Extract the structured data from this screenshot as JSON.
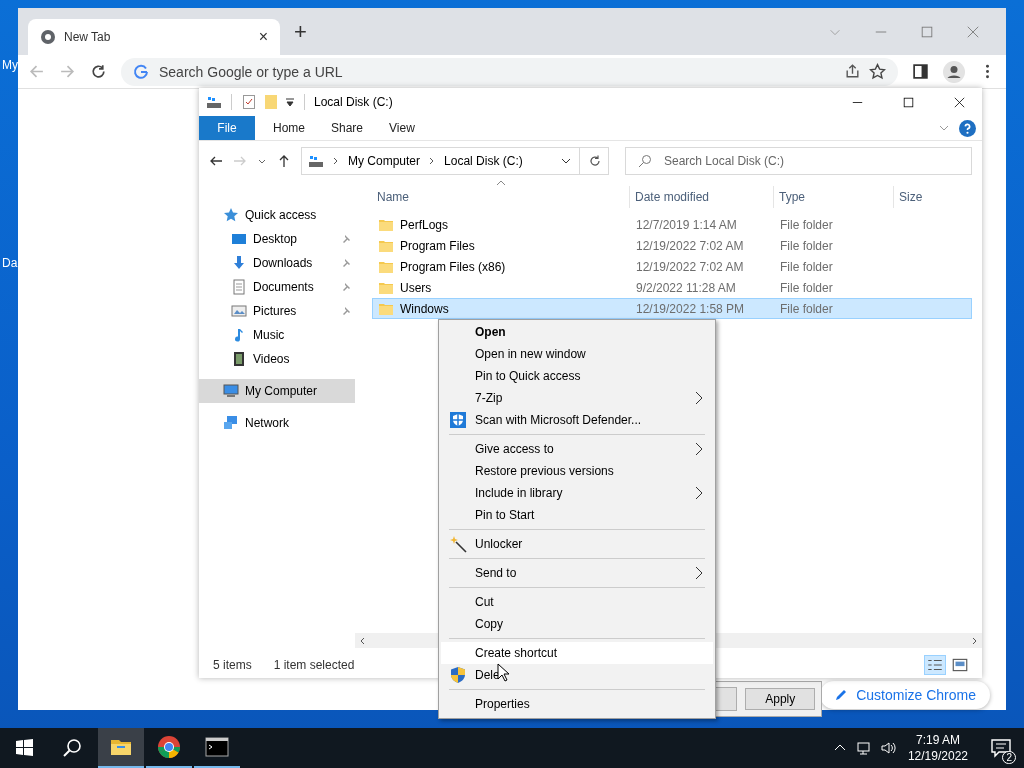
{
  "desktop": {
    "icon_labels": [
      "My",
      "Da"
    ]
  },
  "browser": {
    "tab": {
      "title": "New Tab",
      "close": "×"
    },
    "new_tab": "+",
    "omnibox": {
      "placeholder": "Search Google or type a URL"
    },
    "customize_button": "Customize Chrome"
  },
  "explorer": {
    "title": "Local Disk (C:)",
    "ribbon_tabs": [
      {
        "label": "File",
        "kind": "menu"
      },
      {
        "label": "Home",
        "kind": "tab"
      },
      {
        "label": "Share",
        "kind": "tab"
      },
      {
        "label": "View",
        "kind": "tab"
      }
    ],
    "address": {
      "crumbs": [
        "My Computer",
        "Local Disk (C:)"
      ]
    },
    "search": {
      "placeholder": "Search Local Disk (C:)"
    },
    "nav": [
      {
        "label": "Quick access",
        "kind": "star",
        "selected": false,
        "children": [
          {
            "label": "Desktop",
            "kind": "desktop",
            "selected": false,
            "pinned": true
          },
          {
            "label": "Downloads",
            "kind": "downloads",
            "selected": false,
            "pinned": true
          },
          {
            "label": "Documents",
            "kind": "documents",
            "selected": false,
            "pinned": true
          },
          {
            "label": "Pictures",
            "kind": "pictures",
            "selected": false,
            "pinned": true
          },
          {
            "label": "Music",
            "kind": "music",
            "selected": false,
            "pinned": false
          },
          {
            "label": "Videos",
            "kind": "videos",
            "selected": false,
            "pinned": false
          }
        ]
      },
      {
        "label": "My Computer",
        "kind": "computer",
        "selected": true
      },
      {
        "label": "Network",
        "kind": "network",
        "selected": false
      }
    ],
    "columns": [
      "Name",
      "Date modified",
      "Type",
      "Size"
    ],
    "rows": [
      {
        "name": "PerfLogs",
        "date": "12/7/2019 1:14 AM",
        "type": "File folder",
        "selected": false
      },
      {
        "name": "Program Files",
        "date": "12/19/2022 7:02 AM",
        "type": "File folder",
        "selected": false
      },
      {
        "name": "Program Files (x86)",
        "date": "12/19/2022 7:02 AM",
        "type": "File folder",
        "selected": false
      },
      {
        "name": "Users",
        "date": "9/2/2022 11:28 AM",
        "type": "File folder",
        "selected": false
      },
      {
        "name": "Windows",
        "date": "12/19/2022 1:58 PM",
        "type": "File folder",
        "selected": true
      }
    ],
    "status": {
      "count": "5 items",
      "selection": "1 item selected"
    }
  },
  "dialog": {
    "buttons": [
      "Apply"
    ]
  },
  "context_menu": [
    {
      "kind": "plain",
      "label": "Open",
      "default": true,
      "submenu": false,
      "selected": false
    },
    {
      "kind": "plain",
      "label": "Open in new window",
      "default": false,
      "submenu": false,
      "selected": false
    },
    {
      "kind": "plain",
      "label": "Pin to Quick access",
      "default": false,
      "submenu": false,
      "selected": false
    },
    {
      "kind": "plain",
      "label": "7-Zip",
      "default": false,
      "submenu": true,
      "selected": false
    },
    {
      "kind": "defender",
      "label": "Scan with Microsoft Defender...",
      "default": false,
      "submenu": false,
      "selected": false
    },
    {
      "kind": "separator"
    },
    {
      "kind": "plain",
      "label": "Give access to",
      "default": false,
      "submenu": true,
      "selected": false
    },
    {
      "kind": "plain",
      "label": "Restore previous versions",
      "default": false,
      "submenu": false,
      "selected": false
    },
    {
      "kind": "plain",
      "label": "Include in library",
      "default": false,
      "submenu": true,
      "selected": false
    },
    {
      "kind": "plain",
      "label": "Pin to Start",
      "default": false,
      "submenu": false,
      "selected": false
    },
    {
      "kind": "separator"
    },
    {
      "kind": "unlocker",
      "label": "Unlocker",
      "default": false,
      "submenu": false,
      "selected": false
    },
    {
      "kind": "separator"
    },
    {
      "kind": "plain",
      "label": "Send to",
      "default": false,
      "submenu": true,
      "selected": false
    },
    {
      "kind": "separator"
    },
    {
      "kind": "plain",
      "label": "Cut",
      "default": false,
      "submenu": false,
      "selected": false
    },
    {
      "kind": "plain",
      "label": "Copy",
      "default": false,
      "submenu": false,
      "selected": false
    },
    {
      "kind": "separator"
    },
    {
      "kind": "plain",
      "label": "Create shortcut",
      "default": false,
      "submenu": false,
      "selected": true
    },
    {
      "kind": "elevated",
      "label": "Dele",
      "default": false,
      "submenu": false,
      "selected": false
    },
    {
      "kind": "separator"
    },
    {
      "kind": "plain",
      "label": "Properties",
      "default": false,
      "submenu": false,
      "selected": false
    }
  ],
  "taskbar": {
    "apps": [
      {
        "kind": "explorer",
        "selected": true
      },
      {
        "kind": "chrome",
        "selected": false
      },
      {
        "kind": "terminal",
        "selected": false
      }
    ],
    "time": "7:19 AM",
    "date": "12/19/2022",
    "notifications": "2"
  }
}
